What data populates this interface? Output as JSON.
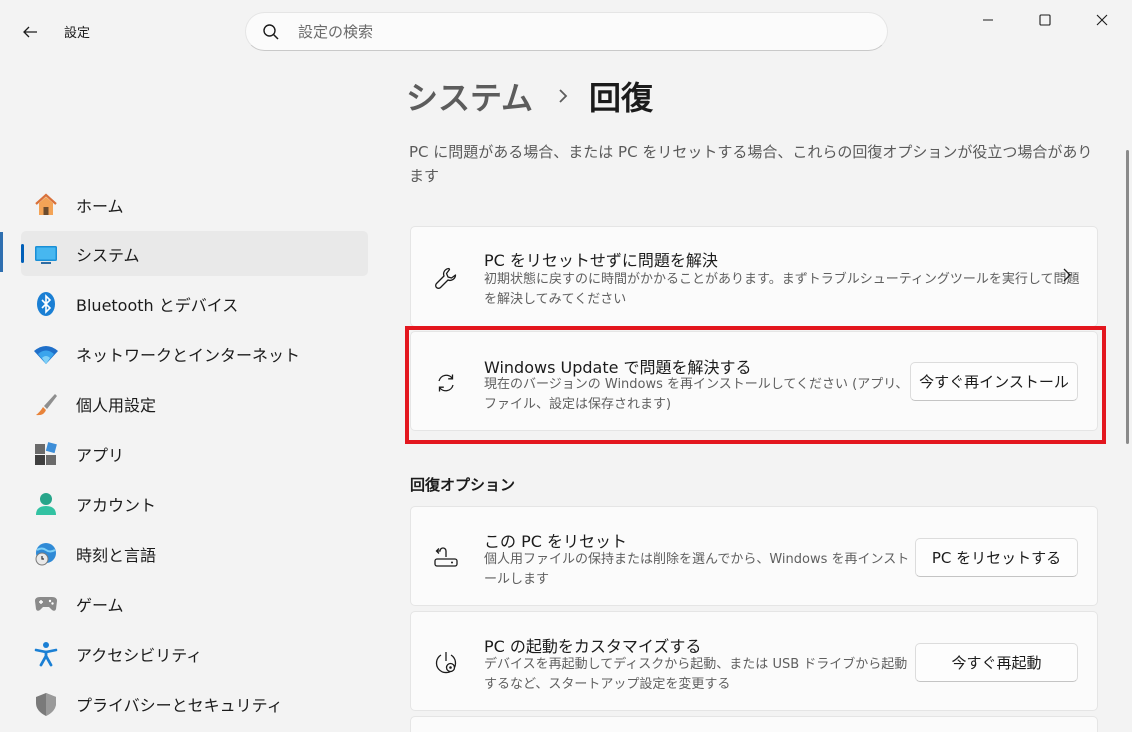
{
  "app_title": "設定",
  "search": {
    "placeholder": "設定の検索"
  },
  "breadcrumb": {
    "parent": "システム",
    "current": "回復"
  },
  "description": "PC に問題がある場合、または PC をリセットする場合、これらの回復オプションが役立つ場合があります",
  "sidebar": {
    "items": [
      {
        "label": "ホーム",
        "icon": "home-icon"
      },
      {
        "label": "システム",
        "icon": "system-icon",
        "selected": true
      },
      {
        "label": "Bluetooth とデバイス",
        "icon": "bluetooth-icon"
      },
      {
        "label": "ネットワークとインターネット",
        "icon": "network-icon"
      },
      {
        "label": "個人用設定",
        "icon": "personalization-icon"
      },
      {
        "label": "アプリ",
        "icon": "apps-icon"
      },
      {
        "label": "アカウント",
        "icon": "account-icon"
      },
      {
        "label": "時刻と言語",
        "icon": "time-language-icon"
      },
      {
        "label": "ゲーム",
        "icon": "gaming-icon"
      },
      {
        "label": "アクセシビリティ",
        "icon": "accessibility-icon"
      },
      {
        "label": "プライバシーとセキュリティ",
        "icon": "privacy-icon"
      }
    ]
  },
  "cards": {
    "troubleshoot": {
      "title": "PC をリセットせずに問題を解決",
      "desc1": "初期状態に戻すのに時間がかかることがあります。まずトラブルシューティングツールを実行して問題",
      "desc2": "を解決してみてください",
      "icon": "wrench-icon"
    },
    "windows_update": {
      "title": "Windows Update で問題を解決する",
      "desc1": "現在のバージョンの Windows を再インストールしてください (アプリ、",
      "desc2": "ファイル、設定は保存されます)",
      "button": "今すぐ再インストール",
      "icon": "refresh-icon"
    }
  },
  "recovery_options": {
    "title": "回復オプション",
    "reset": {
      "title": "この PC をリセット",
      "desc1": "個人用ファイルの保持または削除を選んでから、Windows を再インスト",
      "desc2": "ールします",
      "button": "PC をリセットする",
      "icon": "reset-pc-icon"
    },
    "advanced_startup": {
      "title": "PC の起動をカスタマイズする",
      "desc1": "デバイスを再起動してディスクから起動、または USB ドライブから起動",
      "desc2": "するなど、スタートアップ設定を変更する",
      "button": "今すぐ再起動",
      "icon": "advanced-startup-icon"
    }
  },
  "colors": {
    "accent": "#005fb8",
    "highlight_border": "#e3161e",
    "background": "#f3f3f3"
  }
}
